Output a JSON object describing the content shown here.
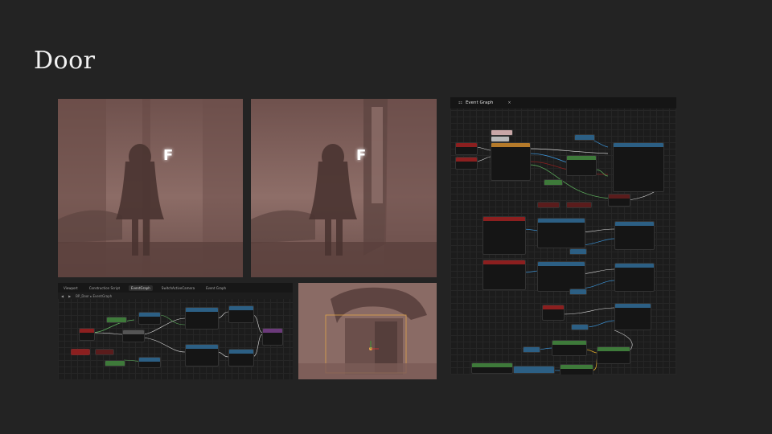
{
  "slide": {
    "title": "Door"
  },
  "screenshots": {
    "gameplay_left": {
      "prompt_key": "F"
    },
    "gameplay_right": {
      "prompt_key": "F"
    }
  },
  "bp_small": {
    "tabs": [
      "Viewport",
      "Construction Script",
      "EventGraph",
      "SwitchActiveCamera",
      "Event Graph"
    ],
    "breadcrumb": "BP_Door ▸ EventGraph",
    "nodes": [
      {
        "title": "BeginOverlap"
      },
      {
        "title": "EndOverlap"
      },
      {
        "title": "Branch"
      },
      {
        "title": "Cast To BP_Player"
      },
      {
        "title": "Set Visibility"
      },
      {
        "title": "Set Visibility"
      },
      {
        "title": "Print String"
      },
      {
        "title": "Print String"
      },
      {
        "title": "Open Level"
      }
    ]
  },
  "bp_large": {
    "tab": "Event Graph",
    "tab_close": "×"
  },
  "colors": {
    "bg": "#232323",
    "node_exec_red": "#8c1f1f",
    "node_blue": "#2c5f84",
    "node_green": "#3e7a3a",
    "wire_exec": "#dddddd",
    "wire_object": "#3a8fd0",
    "wire_bool": "#8a1f1f",
    "wire_green": "#5fb35f",
    "wire_gold": "#d4a42b"
  }
}
